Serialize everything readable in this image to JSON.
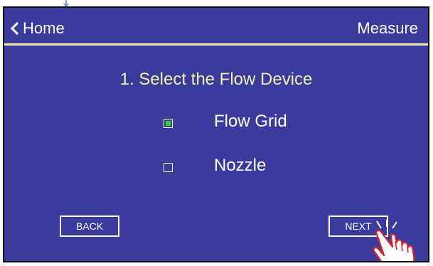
{
  "header": {
    "back_label": "Home",
    "title": "Measure"
  },
  "step": {
    "title": "1. Select the Flow Device"
  },
  "options": [
    {
      "label": "Flow Grid",
      "selected": true
    },
    {
      "label": "Nozzle",
      "selected": false
    }
  ],
  "buttons": {
    "back_label": "BACK",
    "next_label": "NEXT"
  },
  "icons": {
    "back": "chevron-left-icon",
    "pointer": "tap-hand-icon",
    "top_marker": "pointer-arrow-icon"
  },
  "colors": {
    "background": "#3a3b9c",
    "accent": "#f2eeb0",
    "selected": "#22dd22",
    "text": "#ffffff"
  }
}
